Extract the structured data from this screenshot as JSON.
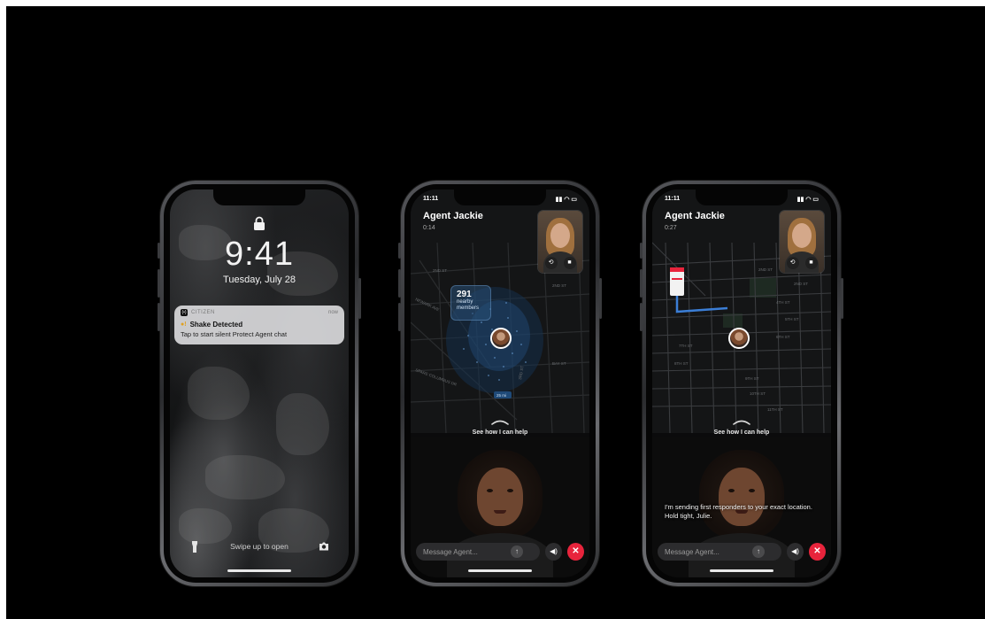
{
  "lock_screen": {
    "time": "9:41",
    "date": "Tuesday, July 28",
    "notification": {
      "app_name": "CITIZEN",
      "app_badge": "(•)",
      "age": "now",
      "title": "Shake Detected",
      "body": "Tap to start silent Protect Agent chat"
    },
    "swipe_hint": "Swipe up to open"
  },
  "call_screen_1": {
    "status_time": "11:11",
    "agent_name": "Agent Jackie",
    "call_timer": "0:14",
    "members_count": "291",
    "members_label": "nearby members",
    "help_label": "See how I can help",
    "message_placeholder": "Message Agent...",
    "street_labels": [
      "2ND ST",
      "2ND ST",
      "NEWARK AVE",
      "BAY ST",
      "3RD ST",
      "SPARE COLUMBUS DR",
      "25 mi"
    ]
  },
  "call_screen_2": {
    "status_time": "11:11",
    "agent_name": "Agent Jackie",
    "call_timer": "0:27",
    "help_label": "See how I can help",
    "agent_message": "I'm sending first responders to your exact location. Hold tight, Julie.",
    "message_placeholder": "Message Agent...",
    "street_labels": [
      "2ND ST",
      "2ND ST",
      "4TH ST",
      "5TH ST",
      "6TH ST",
      "7TH ST",
      "8TH ST",
      "9TH ST",
      "10TH ST",
      "11TH ST"
    ]
  },
  "colors": {
    "end_call": "#e8243c",
    "background": "#000000",
    "route_blue": "#3b7ed6"
  }
}
